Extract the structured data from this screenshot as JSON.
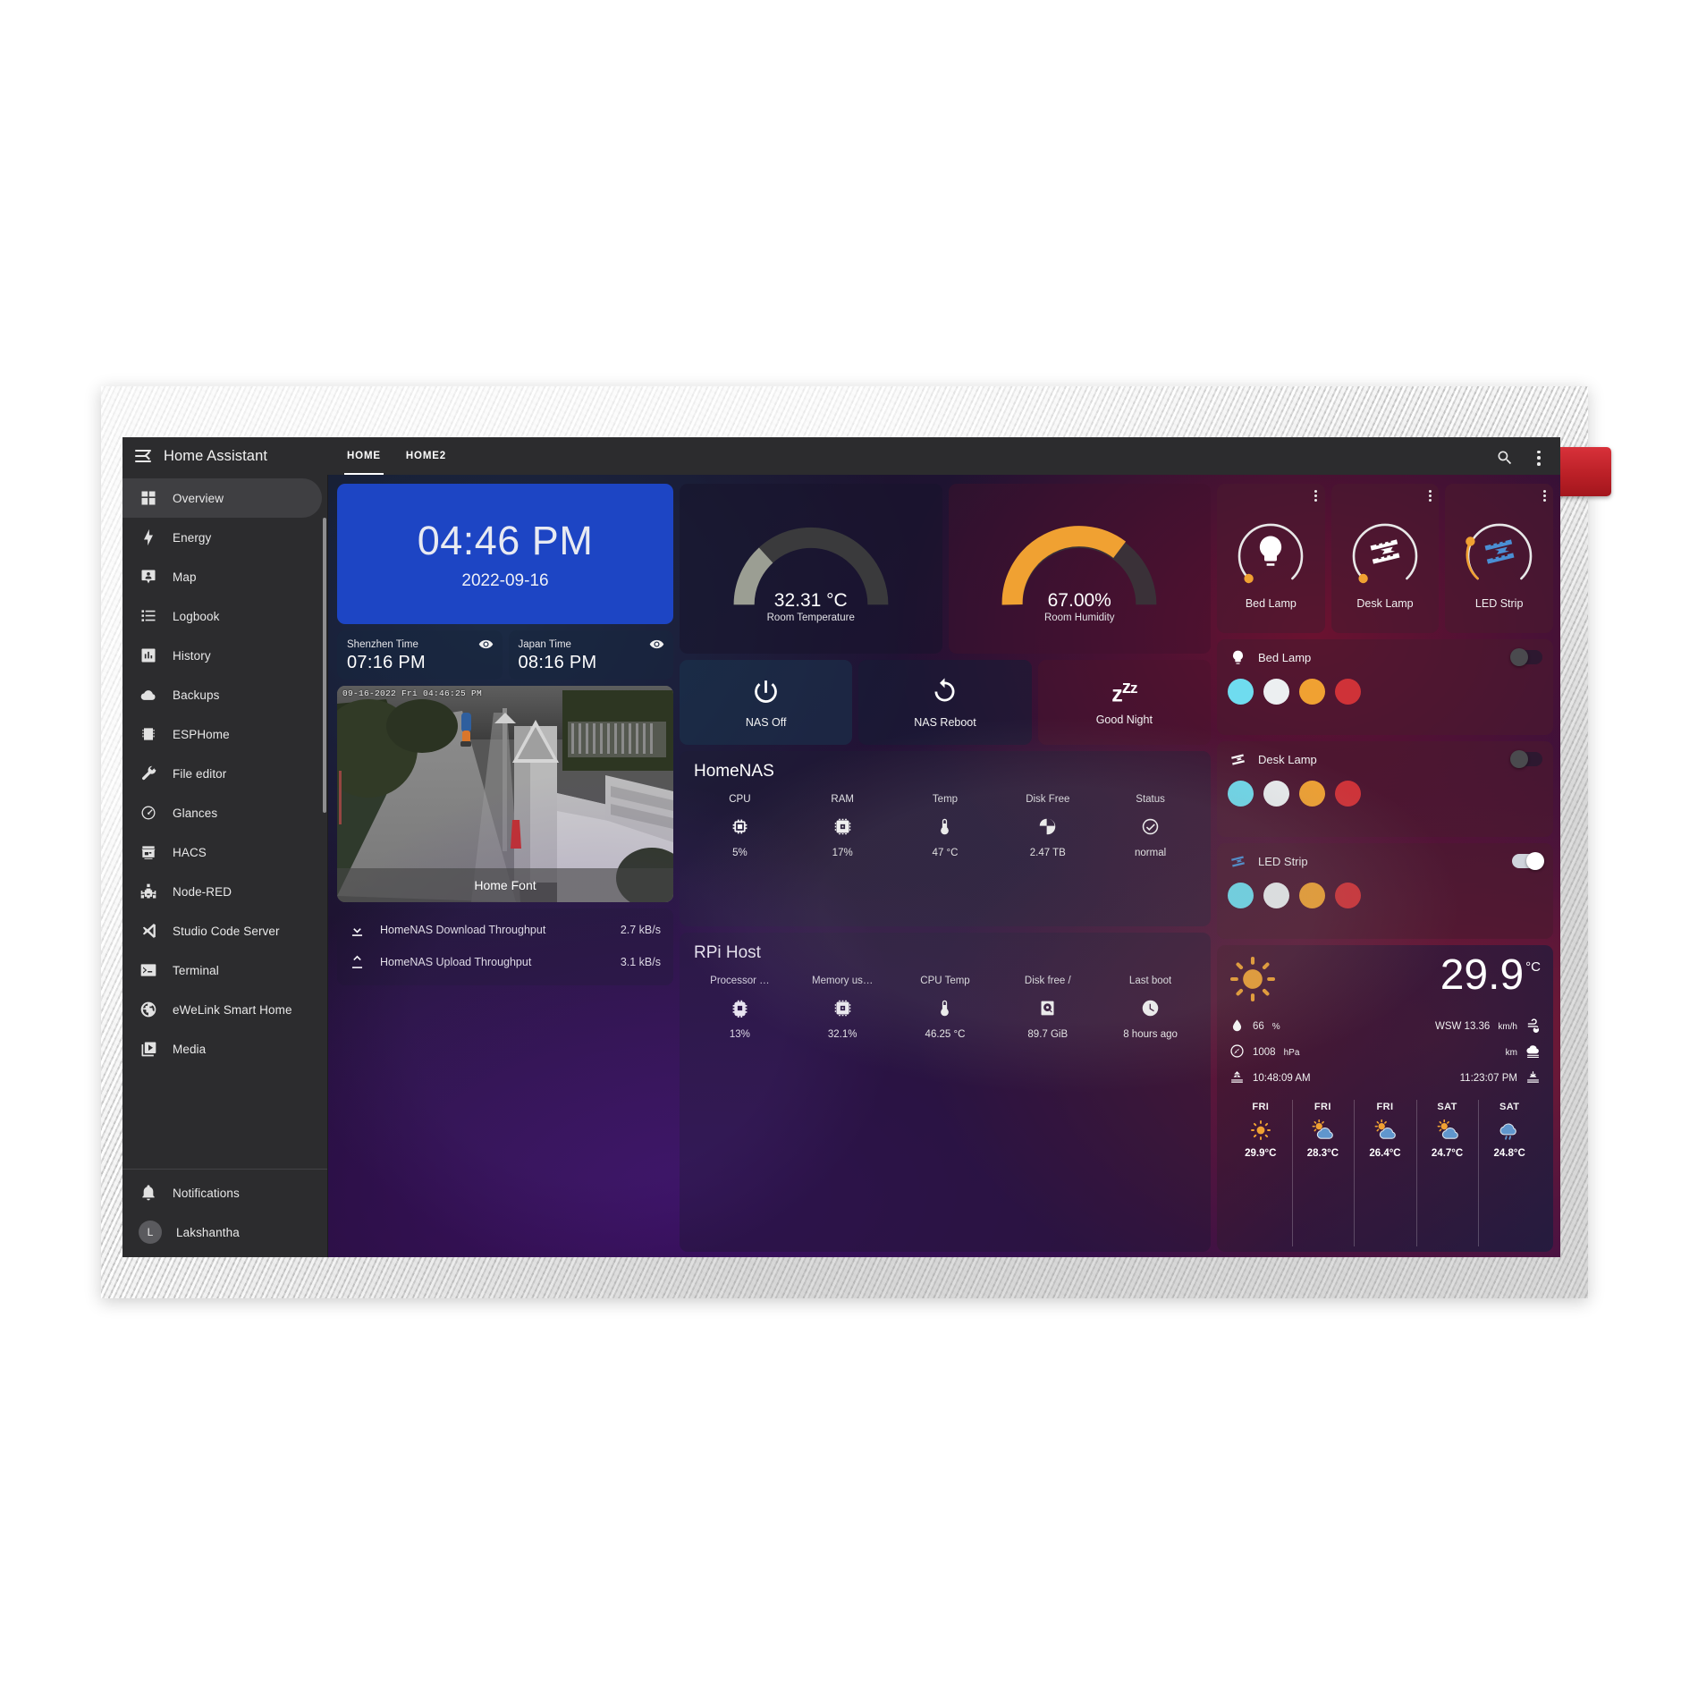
{
  "app": {
    "title": "Home Assistant",
    "menu_icon": "menu-collapse-icon"
  },
  "tabs": [
    {
      "label": "HOME",
      "active": true
    },
    {
      "label": "HOME2",
      "active": false
    }
  ],
  "topbar": {
    "search_icon": "search-icon",
    "overflow_icon": "more-vertical-icon"
  },
  "sidebar": {
    "items": [
      {
        "label": "Overview",
        "icon": "view-dashboard-icon",
        "active": true
      },
      {
        "label": "Energy",
        "icon": "lightning-bolt-icon",
        "active": false
      },
      {
        "label": "Map",
        "icon": "map-marker-account-icon",
        "active": false
      },
      {
        "label": "Logbook",
        "icon": "format-list-icon",
        "active": false
      },
      {
        "label": "History",
        "icon": "chart-box-icon",
        "active": false
      },
      {
        "label": "Backups",
        "icon": "cloud-icon",
        "active": false
      },
      {
        "label": "ESPHome",
        "icon": "chip-icon",
        "active": false
      },
      {
        "label": "File editor",
        "icon": "wrench-icon",
        "active": false
      },
      {
        "label": "Glances",
        "icon": "gauge-icon",
        "active": false
      },
      {
        "label": "HACS",
        "icon": "store-icon",
        "active": false
      },
      {
        "label": "Node-RED",
        "icon": "sitemap-icon",
        "active": false
      },
      {
        "label": "Studio Code Server",
        "icon": "vscode-icon",
        "active": false
      },
      {
        "label": "Terminal",
        "icon": "console-icon",
        "active": false
      },
      {
        "label": "eWeLink Smart Home",
        "icon": "globe-icon",
        "active": false
      },
      {
        "label": "Media",
        "icon": "play-box-multiple-icon",
        "active": false
      }
    ],
    "bottom": [
      {
        "label": "Notifications",
        "icon": "bell-icon"
      }
    ],
    "user": {
      "label": "Lakshantha",
      "initial": "L"
    }
  },
  "clock": {
    "time": "04:46 PM",
    "date": "2022-09-16",
    "bg": "#1d45c4"
  },
  "world_clocks": [
    {
      "name": "Shenzhen Time",
      "time": "07:16 PM",
      "icon": "eye-icon"
    },
    {
      "name": "Japan Time",
      "time": "08:16 PM",
      "icon": "eye-icon"
    }
  ],
  "camera": {
    "timestamp": "09-16-2022 Fri 04:46:25 PM",
    "label": "Home Font"
  },
  "throughput": [
    {
      "icon": "download-icon",
      "name": "HomeNAS Download Throughput",
      "value": "2.7 kB/s"
    },
    {
      "icon": "upload-icon",
      "name": "HomeNAS Upload Throughput",
      "value": "3.1 kB/s"
    }
  ],
  "gauges": [
    {
      "label": "Room Temperature",
      "value": "32.31 °C",
      "percent": 32,
      "color": "#9b9e93",
      "track": "#3a3a3c"
    },
    {
      "label": "Room Humidity",
      "value": "67.00%",
      "percent": 67,
      "color": "#f0a132",
      "track": "#3a3138"
    }
  ],
  "nas_buttons": [
    {
      "label": "NAS Off",
      "icon": "power-icon"
    },
    {
      "label": "NAS Reboot",
      "icon": "restart-icon"
    },
    {
      "label": "Good Night",
      "icon": "sleep-zzz-icon"
    }
  ],
  "glances": [
    {
      "title": "HomeNAS",
      "columns": [
        {
          "header": "CPU",
          "icon": "memory-icon",
          "value": "5%"
        },
        {
          "header": "RAM",
          "icon": "chip-icon",
          "value": "17%"
        },
        {
          "header": "Temp",
          "icon": "thermometer-icon",
          "value": "47 °C"
        },
        {
          "header": "Disk Free",
          "icon": "chart-pie-icon",
          "value": "2.47 TB"
        },
        {
          "header": "Status",
          "icon": "check-circle-icon",
          "value": "normal"
        }
      ]
    },
    {
      "title": "RPi Host",
      "columns": [
        {
          "header": "Processor …",
          "icon": "cpu-64-icon",
          "value": "13%"
        },
        {
          "header": "Memory us…",
          "icon": "chip-icon",
          "value": "32.1%"
        },
        {
          "header": "CPU Temp",
          "icon": "thermometer-icon",
          "value": "46.25 °C"
        },
        {
          "header": "Disk free /",
          "icon": "harddisk-icon",
          "value": "89.7 GiB"
        },
        {
          "header": "Last boot",
          "icon": "clock-icon",
          "value": "8 hours ago"
        }
      ]
    }
  ],
  "light_tiles": [
    {
      "name": "Bed Lamp",
      "icon": "bulb-icon",
      "brightness_pct": 14,
      "icon_color": "#ffffff",
      "arc_color": "#e8e8e8",
      "handle_color": "#f0a132"
    },
    {
      "name": "Desk Lamp",
      "icon": "ledstrip-icon",
      "brightness_pct": 12,
      "icon_color": "#ffffff",
      "arc_color": "#e8e8e8",
      "handle_color": "#f0a132"
    },
    {
      "name": "LED Strip",
      "icon": "ledstrip-icon",
      "brightness_pct": 28,
      "icon_color": "#4a8fd4",
      "arc_color": "#e8e8e8",
      "handle_color": "#f0a132"
    }
  ],
  "light_controls": [
    {
      "name": "Bed Lamp",
      "icon": "bulb-icon",
      "on": false,
      "swatches": [
        "#6fdcef",
        "#eceff1",
        "#f0a132",
        "#cf3238"
      ]
    },
    {
      "name": "Desk Lamp",
      "icon": "ledstrip-icon",
      "on": false,
      "swatches": [
        "#6fdcef",
        "#eceff1",
        "#f0a132",
        "#cf3238"
      ]
    },
    {
      "name": "LED Strip",
      "icon": "ledstrip-icon",
      "on": true,
      "swatches": [
        "#6fdcef",
        "#eceff1",
        "#f0a132",
        "#cf3238"
      ]
    }
  ],
  "weather": {
    "condition_icon": "sunny-icon",
    "temperature": "29.9",
    "unit": "°C",
    "left": [
      {
        "icon": "humidity-icon",
        "value": "66",
        "unit": "%"
      },
      {
        "icon": "pressure-icon",
        "value": "1008",
        "unit": "hPa"
      },
      {
        "icon": "sunrise-icon",
        "value": "10:48:09 AM",
        "unit": ""
      }
    ],
    "right": [
      {
        "icon": "wind-icon",
        "value": "WSW 13.36",
        "unit": "km/h"
      },
      {
        "icon": "visibility-icon",
        "value": "",
        "unit": "km"
      },
      {
        "icon": "sunset-icon",
        "value": "11:23:07 PM",
        "unit": ""
      }
    ],
    "forecast": [
      {
        "day": "FRI",
        "icon": "sunny-icon",
        "temp": "29.9°C"
      },
      {
        "day": "FRI",
        "icon": "partly-cloudy-icon",
        "temp": "28.3°C"
      },
      {
        "day": "FRI",
        "icon": "partly-cloudy-icon",
        "temp": "26.4°C"
      },
      {
        "day": "SAT",
        "icon": "partly-cloudy-icon",
        "temp": "24.7°C"
      },
      {
        "day": "SAT",
        "icon": "rainy-icon",
        "temp": "24.8°C"
      }
    ]
  }
}
